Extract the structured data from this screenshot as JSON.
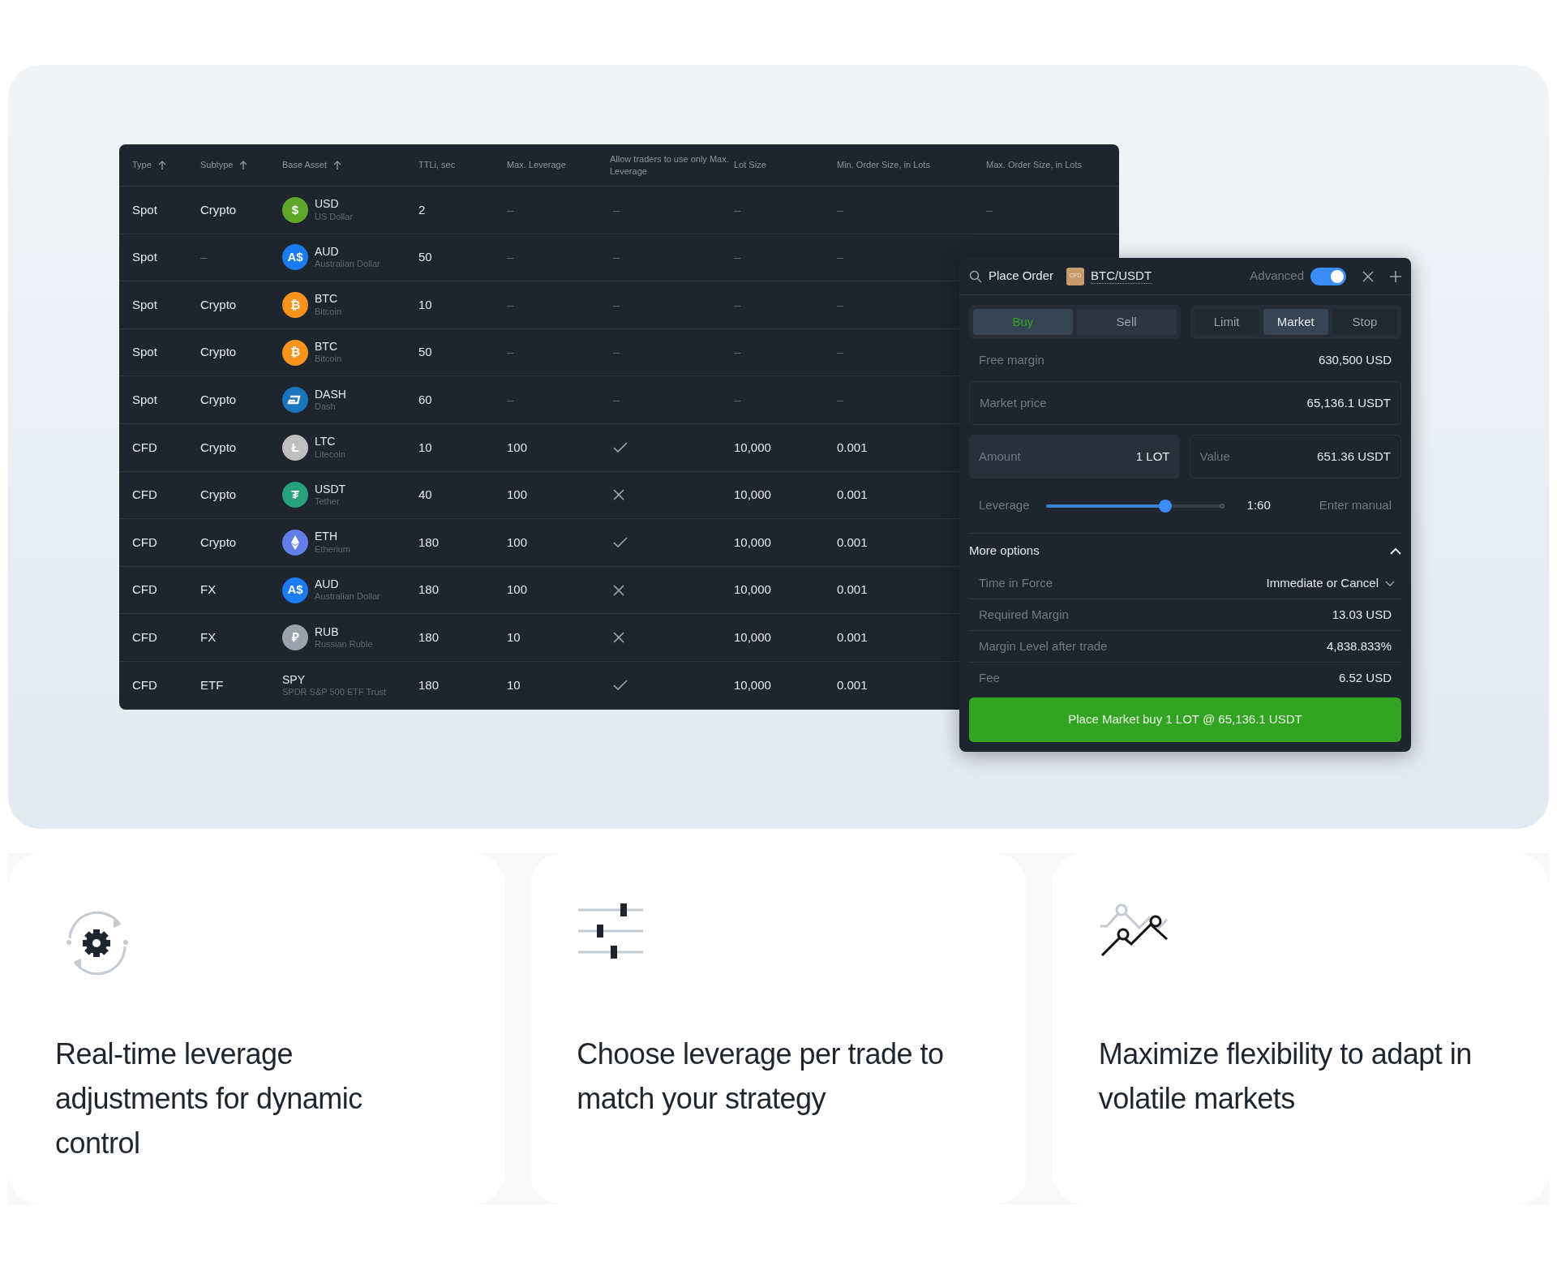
{
  "table": {
    "columns": [
      {
        "label": "Type",
        "sortable": true
      },
      {
        "label": "Subtype",
        "sortable": true
      },
      {
        "label": "Base Asset",
        "sortable": true
      },
      {
        "label": "TTLi, sec",
        "sortable": false
      },
      {
        "label": "Max. Leverage",
        "sortable": false
      },
      {
        "label": "Allow traders to use only Max. Leverage",
        "sortable": false
      },
      {
        "label": "Lot Size",
        "sortable": false
      },
      {
        "label": "Min. Order Size, in Lots",
        "sortable": false
      },
      {
        "label": "Max. Order Size, in Lots",
        "sortable": false
      }
    ],
    "rows": [
      {
        "type": "Spot",
        "subtype": "Crypto",
        "asset": {
          "code": "USD",
          "name": "US Dollar",
          "icon": {
            "kind": "glyph",
            "symbol": "$",
            "color": "#5ea72b"
          }
        },
        "ttl": "2",
        "max_leverage": "–",
        "allow": {
          "kind": "text",
          "text": "–"
        },
        "lot_size": "–",
        "min_order": "–",
        "max_order": "–"
      },
      {
        "type": "Spot",
        "subtype": "–",
        "asset": {
          "code": "AUD",
          "name": "Australian Dollar",
          "icon": {
            "kind": "glyph",
            "symbol": "A$",
            "color": "#1a7cf0"
          }
        },
        "ttl": "50",
        "max_leverage": "–",
        "allow": {
          "kind": "text",
          "text": "–"
        },
        "lot_size": "–",
        "min_order": "–"
      },
      {
        "type": "Spot",
        "subtype": "Crypto",
        "asset": {
          "code": "BTC",
          "name": "Bitcoin",
          "icon": {
            "kind": "glyph",
            "symbol": "₿",
            "color": "#f7931a"
          }
        },
        "ttl": "10",
        "max_leverage": "–",
        "allow": {
          "kind": "text",
          "text": "–"
        },
        "lot_size": "–",
        "min_order": "–"
      },
      {
        "type": "Spot",
        "subtype": "Crypto",
        "asset": {
          "code": "BTC",
          "name": "Bitcoin",
          "icon": {
            "kind": "glyph",
            "symbol": "₿",
            "color": "#f7931a"
          }
        },
        "ttl": "50",
        "max_leverage": "–",
        "allow": {
          "kind": "text",
          "text": "–"
        },
        "lot_size": "–",
        "min_order": "–"
      },
      {
        "type": "Spot",
        "subtype": "Crypto",
        "asset": {
          "code": "DASH",
          "name": "Dash",
          "icon": {
            "kind": "dash",
            "color": "#1c75bc"
          }
        },
        "ttl": "60",
        "max_leverage": "–",
        "allow": {
          "kind": "text",
          "text": "–"
        },
        "lot_size": "–",
        "min_order": "–"
      },
      {
        "type": "CFD",
        "subtype": "Crypto",
        "asset": {
          "code": "LTC",
          "name": "Litecoin",
          "icon": {
            "kind": "glyph",
            "symbol": "Ł",
            "color": "#bfbfbf"
          }
        },
        "ttl": "10",
        "max_leverage": "100",
        "allow": {
          "kind": "check",
          "checked": true
        },
        "lot_size": "10,000",
        "min_order": "0.001"
      },
      {
        "type": "CFD",
        "subtype": "Crypto",
        "asset": {
          "code": "USDT",
          "name": "Tether",
          "icon": {
            "kind": "glyph",
            "symbol": "₮",
            "color": "#26a17b"
          }
        },
        "ttl": "40",
        "max_leverage": "100",
        "allow": {
          "kind": "check",
          "checked": false
        },
        "lot_size": "10,000",
        "min_order": "0.001"
      },
      {
        "type": "CFD",
        "subtype": "Crypto",
        "asset": {
          "code": "ETH",
          "name": "Etherium",
          "icon": {
            "kind": "eth",
            "color": "#627eea"
          }
        },
        "ttl": "180",
        "max_leverage": "100",
        "allow": {
          "kind": "check",
          "checked": true
        },
        "lot_size": "10,000",
        "min_order": "0.001"
      },
      {
        "type": "CFD",
        "subtype": "FX",
        "asset": {
          "code": "AUD",
          "name": "Australian Dollar",
          "icon": {
            "kind": "glyph",
            "symbol": "A$",
            "color": "#1a7cf0"
          }
        },
        "ttl": "180",
        "max_leverage": "100",
        "allow": {
          "kind": "check",
          "checked": false
        },
        "lot_size": "10,000",
        "min_order": "0.001"
      },
      {
        "type": "CFD",
        "subtype": "FX",
        "asset": {
          "code": "RUB",
          "name": "Russian Ruble",
          "icon": {
            "kind": "glyph",
            "symbol": "₽",
            "color": "#9aa3ad"
          }
        },
        "ttl": "180",
        "max_leverage": "10",
        "allow": {
          "kind": "check",
          "checked": false
        },
        "lot_size": "10,000",
        "min_order": "0.001"
      },
      {
        "type": "CFD",
        "subtype": "ETF",
        "asset": {
          "code": "SPY",
          "name": "SPDR S&P 500 ETF Trust"
        },
        "ttl": "180",
        "max_leverage": "10",
        "allow": {
          "kind": "check",
          "checked": true
        },
        "lot_size": "10,000",
        "min_order": "0.001"
      }
    ]
  },
  "order_panel": {
    "title": "Place Order",
    "instrument_badge": "CFD",
    "instrument": "BTC/USDT",
    "advanced": {
      "label": "Advanced",
      "on": true
    },
    "sides": [
      {
        "label": "Buy",
        "selected": true
      },
      {
        "label": "Sell",
        "selected": false
      }
    ],
    "order_types": [
      {
        "label": "Limit",
        "selected": false
      },
      {
        "label": "Market",
        "selected": true
      },
      {
        "label": "Stop",
        "selected": false
      }
    ],
    "free_margin": {
      "label": "Free margin",
      "value": "630,500 USD"
    },
    "market_price": {
      "label": "Market price",
      "value": "65,136.1 USDT"
    },
    "amount": {
      "label": "Amount",
      "value": "1 LOT"
    },
    "value": {
      "label": "Value",
      "value": "651.36 USDT"
    },
    "leverage": {
      "label": "Leverage",
      "level": 0.67,
      "reading": "1:60",
      "manual": "Enter manual"
    },
    "more_options": {
      "label": "More options",
      "expanded": true,
      "rows": [
        {
          "kind": "select",
          "label": "Time in Force",
          "value": "Immediate or Cancel"
        },
        {
          "kind": "text",
          "label": "Required Margin",
          "value": "13.03 USD"
        },
        {
          "kind": "text",
          "label": "Margin Level after trade",
          "value": "4,838.833%"
        },
        {
          "kind": "text",
          "label": "Fee",
          "value": "6.52 USD"
        }
      ]
    },
    "submit": "Place Market buy 1 LOT @ 65,136.1 USDT"
  },
  "features": [
    {
      "title": "Real-time leverage adjustments for dynamic control"
    },
    {
      "title": "Choose leverage per trade to match your strategy"
    },
    {
      "title": "Maximize flexibility to adapt in volatile markets"
    }
  ]
}
